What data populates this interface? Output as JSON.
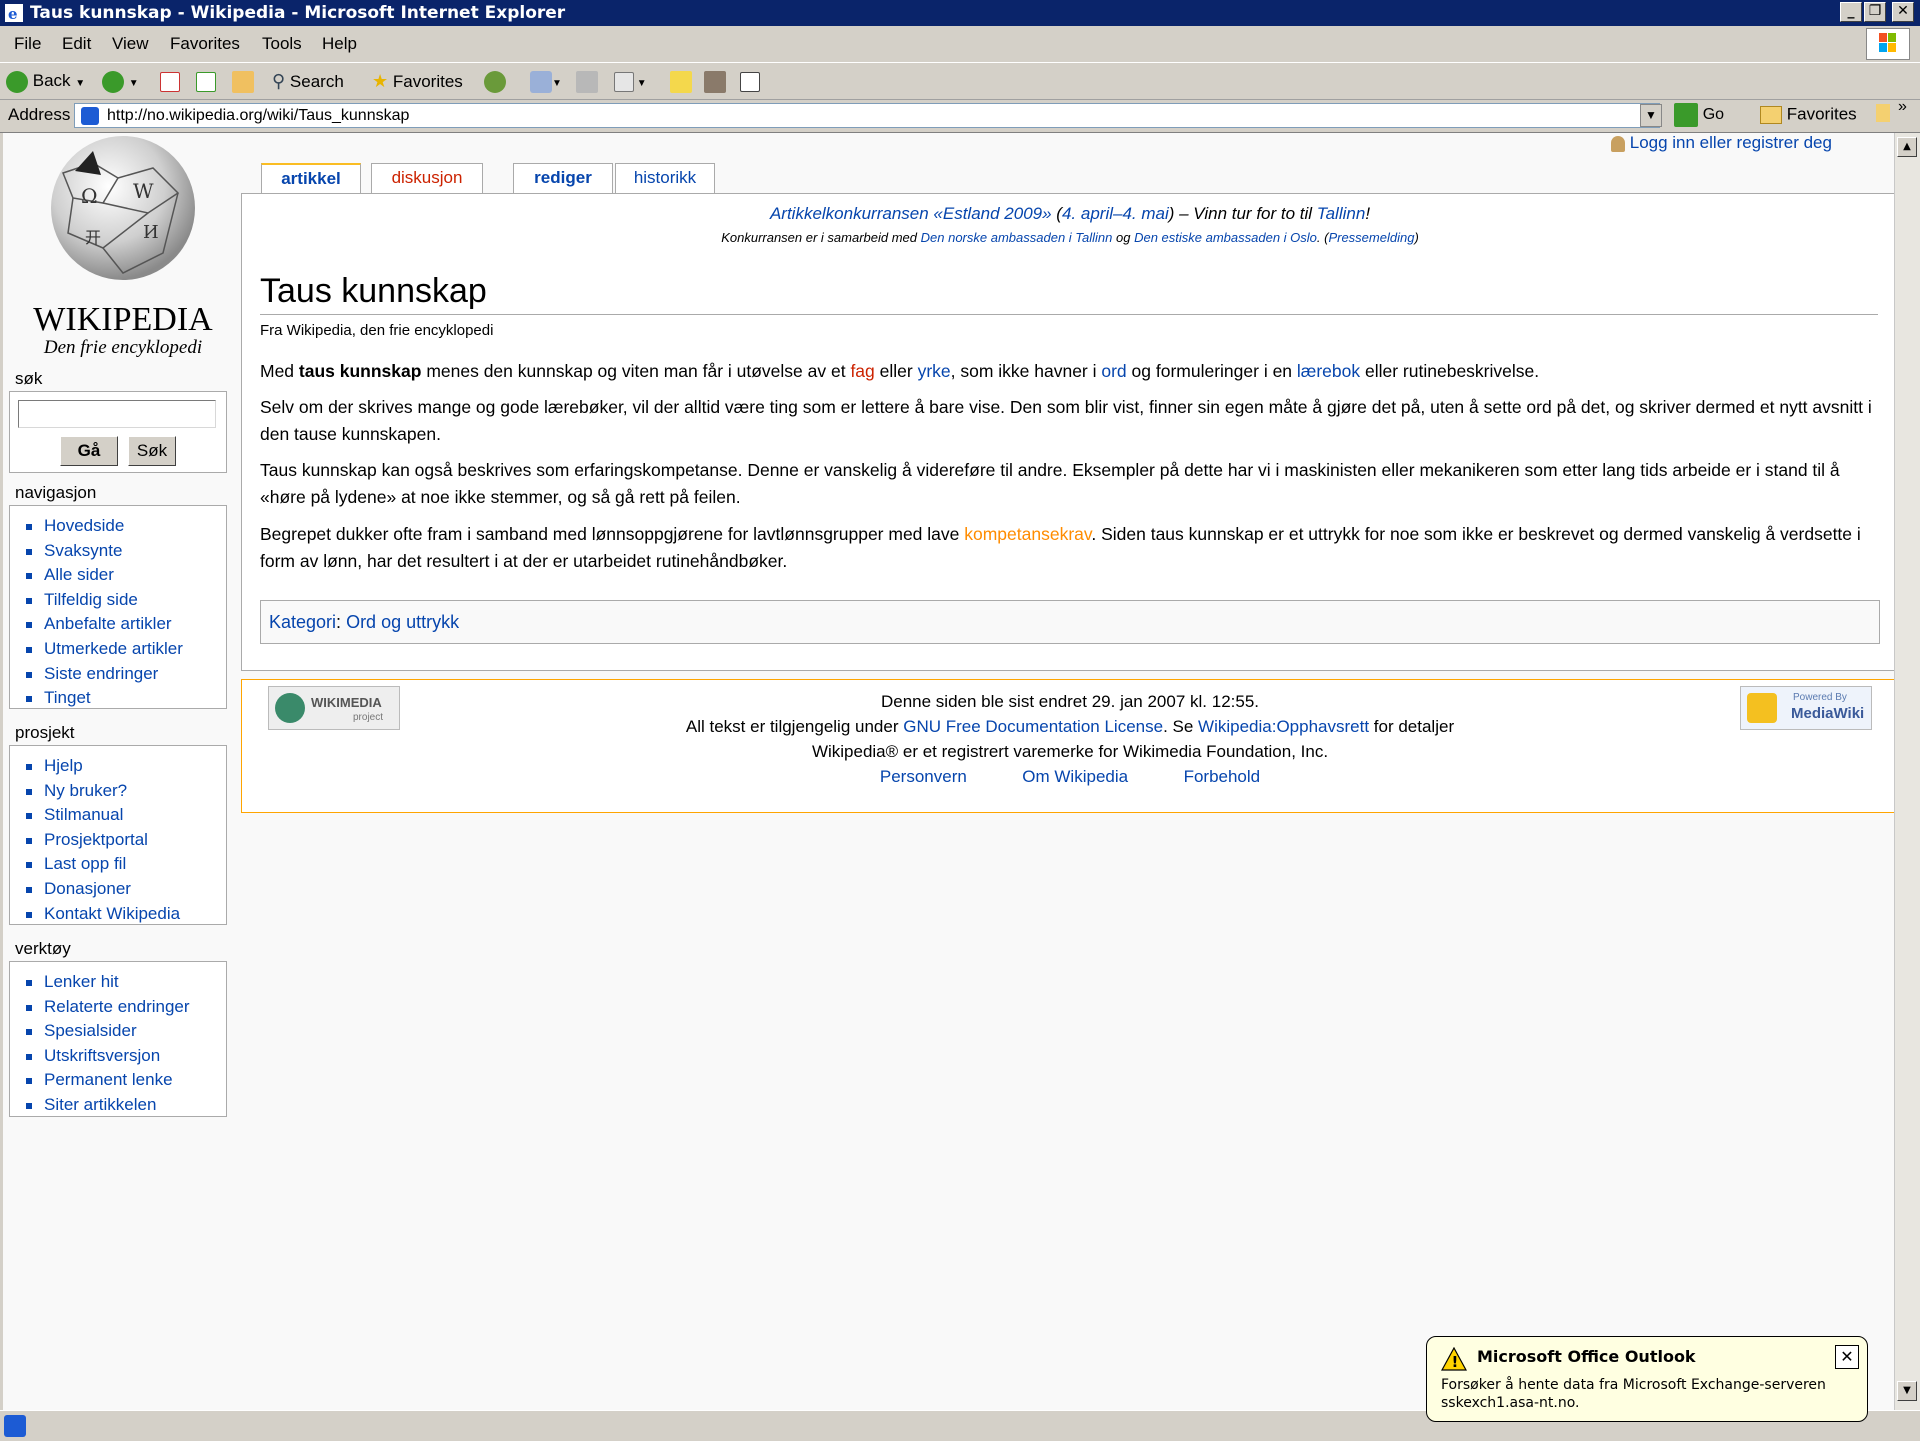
{
  "window": {
    "title": "Taus kunnskap - Wikipedia - Microsoft Internet Explorer"
  },
  "menu": [
    "File",
    "Edit",
    "View",
    "Favorites",
    "Tools",
    "Help"
  ],
  "toolbar": {
    "back": "Back",
    "search": "Search",
    "favorites": "Favorites"
  },
  "address": {
    "label": "Address",
    "url": "http://no.wikipedia.org/wiki/Taus_kunnskap",
    "go": "Go",
    "favorites": "Favorites"
  },
  "wiki": {
    "logo_title": "WIKIPEDIA",
    "logo_subtitle": "Den frie encyklopedi",
    "login": "Logg inn eller registrer deg",
    "tabs": [
      "artikkel",
      "diskusjon",
      "rediger",
      "historikk"
    ],
    "search": {
      "heading": "søk",
      "go_button": "Gå",
      "search_button": "Søk"
    },
    "navigation": {
      "heading": "navigasjon",
      "items": [
        "Hovedside",
        "Svaksynte",
        "Alle sider",
        "Tilfeldig side",
        "Anbefalte artikler",
        "Utmerkede artikler",
        "Siste endringer",
        "Tinget"
      ]
    },
    "project": {
      "heading": "prosjekt",
      "items": [
        "Hjelp",
        "Ny bruker?",
        "Stilmanual",
        "Prosjektportal",
        "Last opp fil",
        "Donasjoner",
        "Kontakt Wikipedia"
      ]
    },
    "tools": {
      "heading": "verktøy",
      "items": [
        "Lenker hit",
        "Relaterte endringer",
        "Spesialsider",
        "Utskriftsversjon",
        "Permanent lenke",
        "Siter artikkelen"
      ]
    },
    "banner": {
      "link1": "Artikkelkonkurransen «Estland 2009»",
      "paren_open": " (",
      "date_link": "4. april–4. mai",
      "paren_close": ") – Vinn tur for to til ",
      "city_link": "Tallinn",
      "excl": "!",
      "sub_text1": "Konkurransen er i samarbeid med ",
      "sub_link1": "Den norske ambassaden i Tallinn",
      "sub_text2": " og ",
      "sub_link2": "Den estiske ambassaden i Oslo",
      "sub_text3": ". (",
      "sub_link3": "Pressemelding",
      "sub_text4": ")"
    },
    "article": {
      "title": "Taus kunnskap",
      "tagline": "Fra Wikipedia, den frie encyklopedi",
      "p1": {
        "t1": "Med ",
        "bold": "taus kunnskap",
        "t2": " menes den kunnskap og viten man får i utøvelse av et ",
        "l1": "fag",
        "t3": " eller ",
        "l2": "yrke",
        "t4": ", som ikke havner i ",
        "l3": "ord",
        "t5": " og formuleringer i en ",
        "l4": "lærebok",
        "t6": " eller rutinebeskrivelse."
      },
      "p2": "Selv om der skrives mange og gode lærebøker, vil der alltid være ting som er lettere å bare vise. Den som blir vist, finner sin egen måte å gjøre det på, uten å sette ord på det, og skriver dermed et nytt avsnitt i den tause kunnskapen.",
      "p3": "Taus kunnskap kan også beskrives som erfaringskompetanse. Denne er vanskelig å videreføre til andre. Eksempler på dette har vi i maskinisten eller mekanikeren som etter lang tids arbeide er i stand til å «høre på lydene» at noe ikke stemmer, og så gå rett på feilen.",
      "p4": {
        "t1": "Begrepet dukker ofte fram i samband med lønnsoppgjørene for lavtlønnsgrupper med lave ",
        "l1": "kompetansekrav",
        "t2": ". Siden taus kunnskap er et uttrykk for noe som ikke er beskrevet og dermed vanskelig å verdsette i form av lønn, har det resultert i at der er utarbeidet rutinehåndbøker."
      },
      "category_label": "Kategori",
      "category_sep": ": ",
      "category": "Ord og uttrykk"
    },
    "footer": {
      "line1": "Denne siden ble sist endret 29. jan 2007 kl. 12:55.",
      "line2_t1": "All tekst er tilgjengelig under ",
      "line2_l1": "GNU Free Documentation License",
      "line2_t2": ". Se ",
      "line2_l2": "Wikipedia:Opphavsrett",
      "line2_t3": " for detaljer",
      "line3": "Wikipedia® er et registrert varemerke for Wikimedia Foundation, Inc.",
      "links": [
        "Personvern",
        "Om Wikipedia",
        "Forbehold"
      ],
      "wikimedia_badge": "WIKIMEDIA",
      "wikimedia_sub": "project",
      "mediawiki_top": "Powered By",
      "mediawiki_bottom": "MediaWiki"
    }
  },
  "toast": {
    "title": "Microsoft Office Outlook",
    "message_line1": "Forsøker å hente data fra Microsoft Exchange-serveren",
    "message_line2": "sskexch1.asa-nt.no."
  }
}
